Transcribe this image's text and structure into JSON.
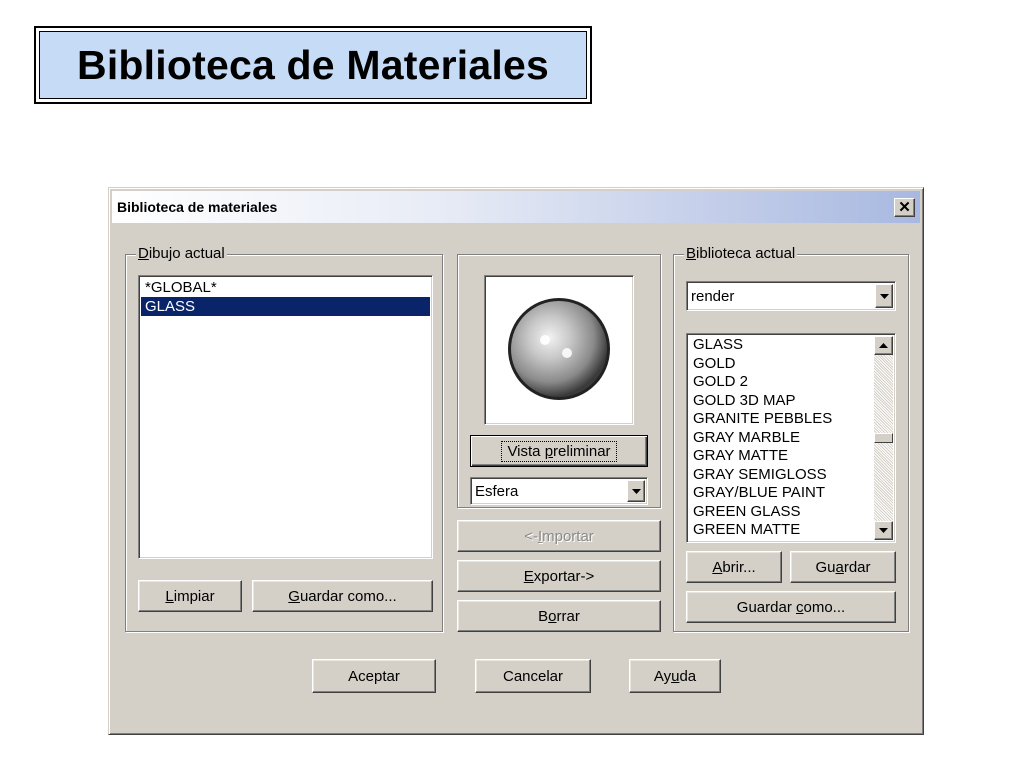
{
  "slide": {
    "title": "Biblioteca de Materiales"
  },
  "dialog": {
    "title": "Biblioteca de materiales",
    "close_glyph": "✕"
  },
  "current_drawing": {
    "legend_pre": "",
    "legend_u": "D",
    "legend_post": "ibujo actual",
    "items": [
      "*GLOBAL*",
      "GLASS"
    ],
    "selected": "GLASS",
    "clear_button": {
      "pre": "",
      "u": "L",
      "post": "impiar"
    },
    "save_as_button": {
      "pre": "",
      "u": "G",
      "post": "uardar como..."
    }
  },
  "preview": {
    "preview_button": {
      "pre": "Vista ",
      "u": "p",
      "post": "reliminar"
    },
    "shape_value": "Esfera",
    "import_button": {
      "pre": "<-",
      "u": "I",
      "post": "mportar",
      "enabled": false
    },
    "export_button": {
      "pre": "",
      "u": "E",
      "post": "xportar->"
    },
    "delete_button": {
      "pre": "B",
      "u": "o",
      "post": "rrar"
    }
  },
  "current_library": {
    "legend_pre": "",
    "legend_u": "B",
    "legend_post": "iblioteca actual",
    "library_value": "render",
    "items": [
      "GLASS",
      "GOLD",
      "GOLD 2",
      "GOLD 3D MAP",
      "GRANITE PEBBLES",
      "GRAY MARBLE",
      "GRAY MATTE",
      "GRAY SEMIGLOSS",
      "GRAY/BLUE PAINT",
      "GREEN GLASS",
      "GREEN MATTE"
    ],
    "open_button": {
      "pre": "",
      "u": "A",
      "post": "brir..."
    },
    "save_button": {
      "pre": "Gu",
      "u": "a",
      "post": "rdar"
    },
    "save_as_button": {
      "pre": "Guardar ",
      "u": "c",
      "post": "omo..."
    }
  },
  "footer": {
    "ok_label": "Aceptar",
    "cancel_label": "Cancelar",
    "help_button": {
      "pre": "Ay",
      "u": "u",
      "post": "da"
    }
  },
  "colors": {
    "selection": "#0a246a",
    "face": "#d4d0c8",
    "title_band": "#c6dcf6"
  }
}
